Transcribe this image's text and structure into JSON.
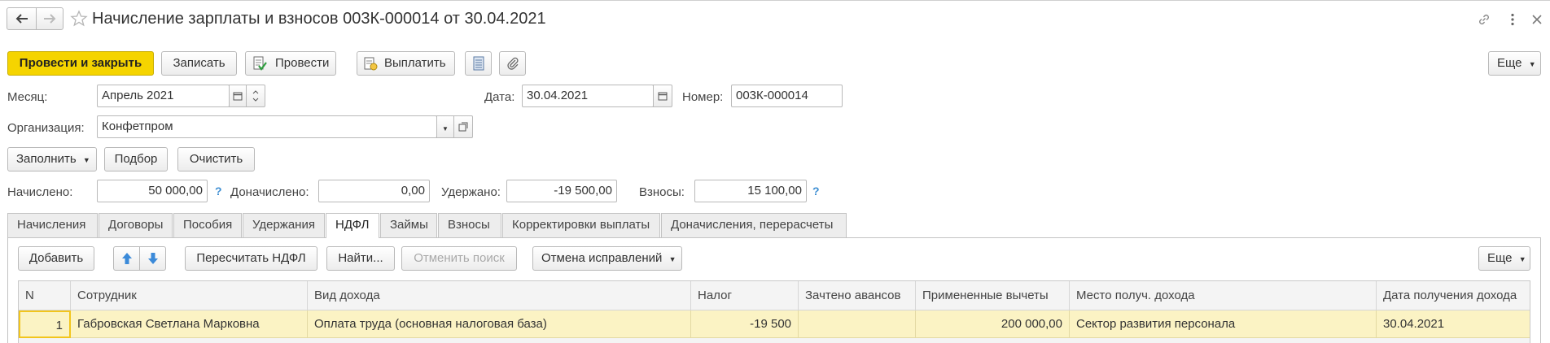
{
  "header": {
    "title": "Начисление зарплаты и взносов 003К-000014 от 30.04.2021"
  },
  "toolbar": {
    "post_close": "Провести и закрыть",
    "save": "Записать",
    "post": "Провести",
    "pay": "Выплатить",
    "more": "Еще"
  },
  "form": {
    "month_label": "Месяц:",
    "month_value": "Апрель 2021",
    "date_label": "Дата:",
    "date_value": "30.04.2021",
    "number_label": "Номер:",
    "number_value": "003К-000014",
    "org_label": "Организация:",
    "org_value": "Конфетпром",
    "fill": "Заполнить",
    "select": "Подбор",
    "clear": "Очистить"
  },
  "totals": {
    "accrued_label": "Начислено:",
    "accrued_value": "50 000,00",
    "additional_label": "Доначислено:",
    "additional_value": "0,00",
    "withheld_label": "Удержано:",
    "withheld_value": "-19 500,00",
    "contributions_label": "Взносы:",
    "contributions_value": "15 100,00",
    "help": "?"
  },
  "tabs": [
    {
      "label": "Начисления"
    },
    {
      "label": "Договоры"
    },
    {
      "label": "Пособия"
    },
    {
      "label": "Удержания"
    },
    {
      "label": "НДФЛ"
    },
    {
      "label": "Займы"
    },
    {
      "label": "Взносы"
    },
    {
      "label": "Корректировки выплаты"
    },
    {
      "label": "Доначисления, перерасчеты"
    }
  ],
  "table_toolbar": {
    "add": "Добавить",
    "recalc": "Пересчитать НДФЛ",
    "find": "Найти...",
    "cancel_search": "Отменить поиск",
    "cancel_fix": "Отмена исправлений",
    "more": "Еще"
  },
  "table": {
    "columns": [
      "N",
      "Сотрудник",
      "Вид дохода",
      "Налог",
      "Зачтено авансов",
      "Примененные вычеты",
      "Место получ. дохода",
      "Дата получения дохода"
    ],
    "rows": [
      [
        "1",
        "Габровская Светлана Марковна",
        "Оплата труда (основная налоговая база)",
        "-19 500",
        "",
        "200 000,00",
        "Сектор развития персонала",
        "30.04.2021"
      ]
    ]
  },
  "colors": {
    "accent": "#f5d400",
    "selected_row": "#fbf3c4",
    "help": "#3f8fd3"
  }
}
